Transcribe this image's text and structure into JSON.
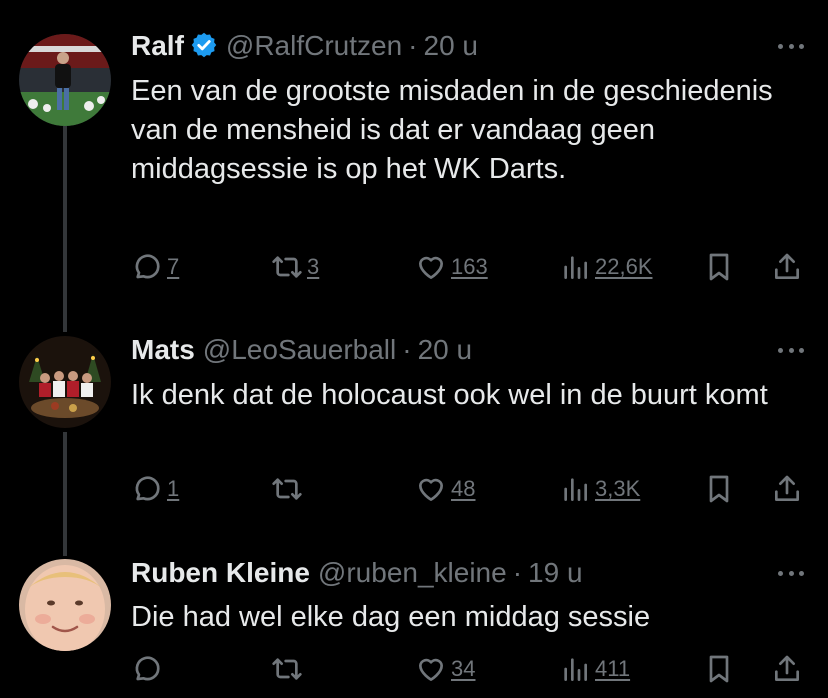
{
  "tweets": [
    {
      "name": "Ralf",
      "verified": true,
      "handle": "@RalfCrutzen",
      "separator": "·",
      "time": "20 u",
      "text": "Een van de grootste misdaden in de geschiedenis van de mensheid is dat er vandaag geen middagsessie is op het WK Darts.",
      "replies": "7",
      "retweets": "3",
      "likes": "163",
      "views": "22,6K"
    },
    {
      "name": "Mats",
      "verified": false,
      "handle": "@LeoSauerball",
      "separator": "·",
      "time": "20 u",
      "text": "Ik denk dat de holocaust ook wel in de buurt komt",
      "replies": "1",
      "retweets": "",
      "likes": "48",
      "views": "3,3K"
    },
    {
      "name": "Ruben Kleine",
      "verified": false,
      "handle": "@ruben_kleine",
      "separator": "·",
      "time": "19 u",
      "text": "Die had wel elke dag een middag sessie",
      "replies": "",
      "retweets": "",
      "likes": "34",
      "views": "411"
    }
  ],
  "colors": {
    "background": "#000000",
    "text": "#e7e9ea",
    "muted": "#71767b",
    "verified": "#1d9bf0",
    "thread_line": "#333639"
  }
}
